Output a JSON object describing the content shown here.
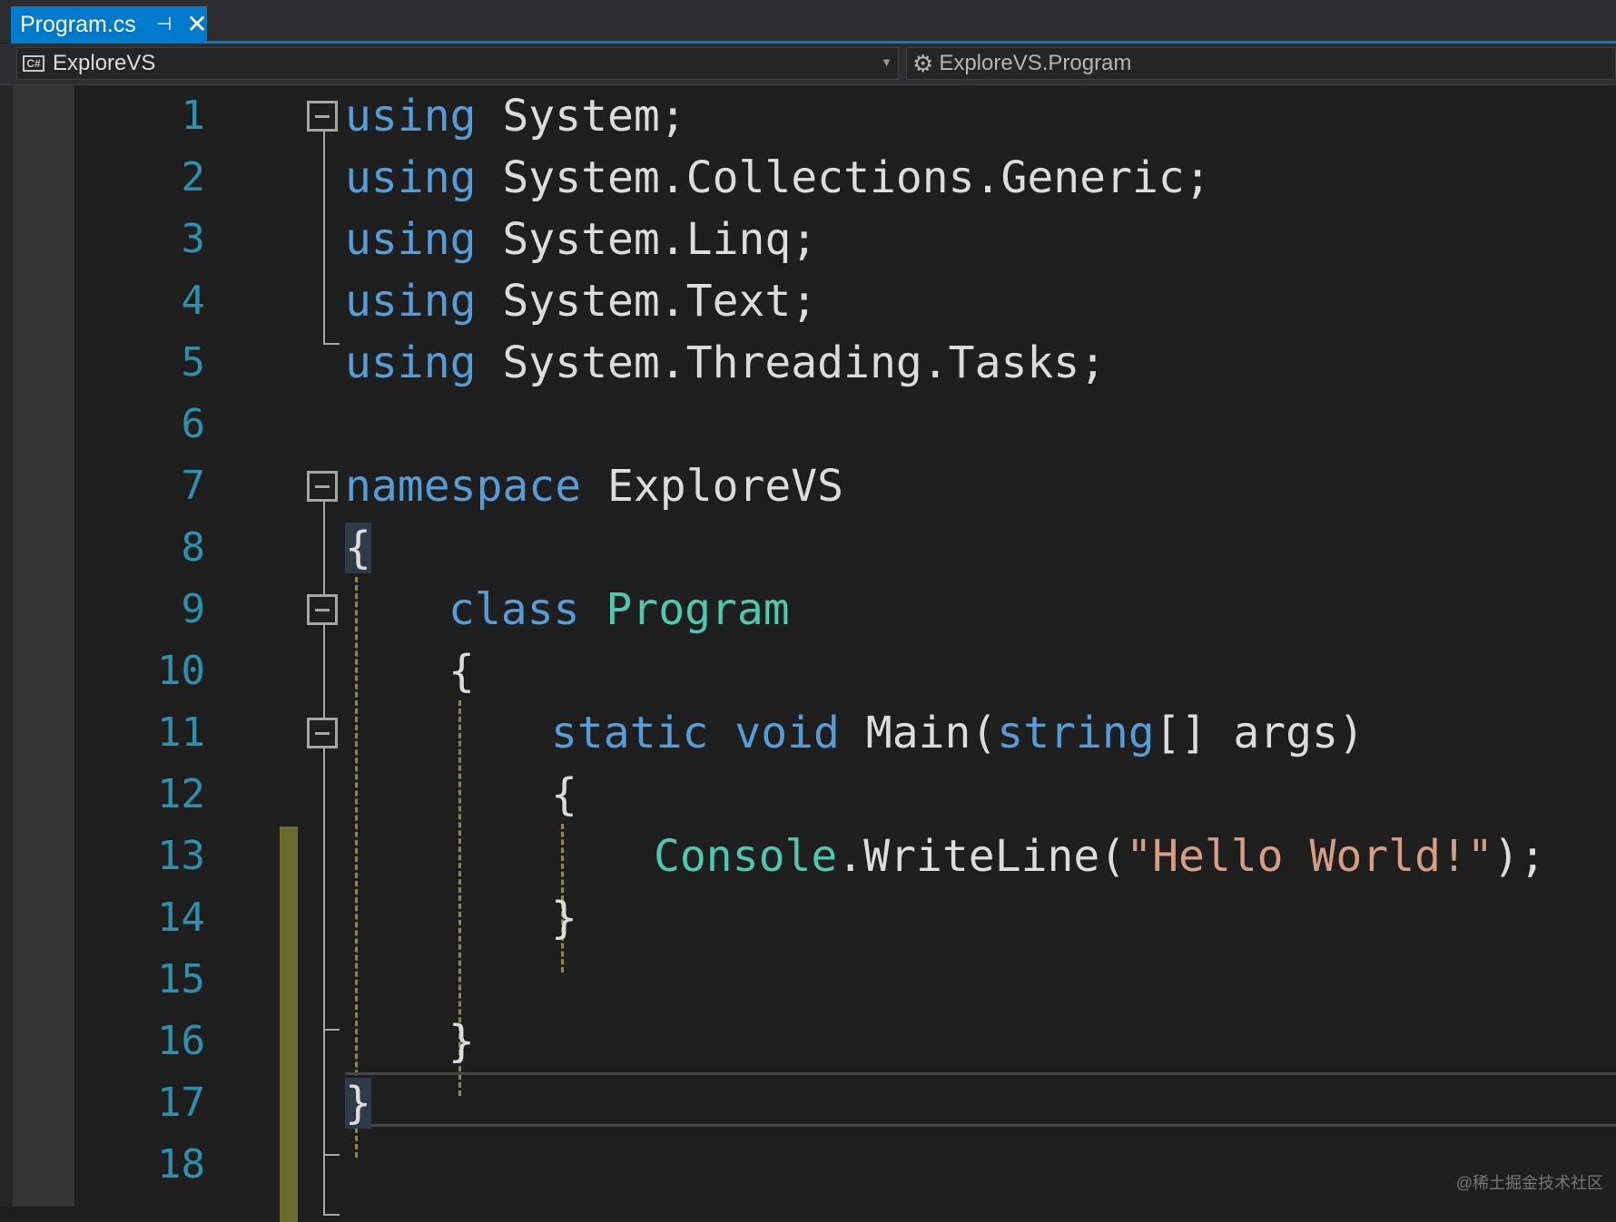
{
  "tab": {
    "title": "Program.cs",
    "pin_icon": "pin-icon",
    "close_icon": "close-icon"
  },
  "navbar": {
    "project": {
      "label": "ExploreVS",
      "icon_text": "C#",
      "icon": "csharp-project-icon"
    },
    "member": {
      "label": "ExploreVS.Program",
      "icon": "class-icon"
    }
  },
  "editor": {
    "line_numbers": [
      "1",
      "2",
      "3",
      "4",
      "5",
      "6",
      "7",
      "8",
      "9",
      "10",
      "11",
      "12",
      "13",
      "14",
      "15",
      "16",
      "17",
      "18"
    ],
    "code": {
      "l1": {
        "kw": "using",
        "rest": " System;"
      },
      "l2": {
        "kw": "using",
        "rest": " System.Collections.Generic;"
      },
      "l3": {
        "kw": "using",
        "rest": " System.Linq;"
      },
      "l4": {
        "kw": "using",
        "rest": " System.Text;"
      },
      "l5": {
        "kw": "using",
        "rest": " System.Threading.Tasks;"
      },
      "l7": {
        "kw": "namespace",
        "rest": " ExploreVS"
      },
      "l8": {
        "brace": "{"
      },
      "l9": {
        "kw": "class",
        "type": "Program"
      },
      "l10": {
        "brace": "{"
      },
      "l11": {
        "kw1": "static",
        "kw2": "void",
        "name": "Main(",
        "kw3": "string",
        "rest": "[] args)"
      },
      "l12": {
        "brace": "{"
      },
      "l13": {
        "type": "Console",
        "rest1": ".WriteLine(",
        "str": "\"Hello World!\"",
        "rest2": ");"
      },
      "l14": {
        "brace": "}"
      },
      "l16": {
        "brace": "}"
      },
      "l17": {
        "brace": "}"
      }
    }
  },
  "watermark": "@稀土掘金技术社区",
  "colors": {
    "keyword": "#569cd6",
    "type": "#4ec9b0",
    "string": "#d69d85",
    "line_number": "#2b91af",
    "accent": "#007acc",
    "change_bar": "#6b6b2e"
  }
}
